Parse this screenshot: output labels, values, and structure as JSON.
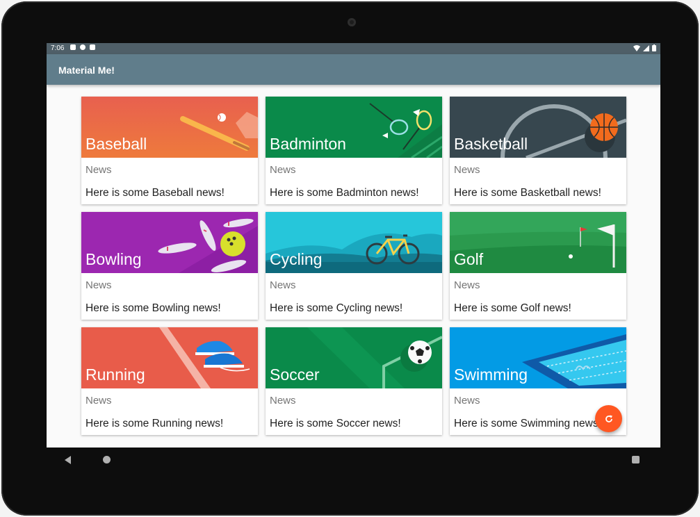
{
  "status_bar": {
    "time": "7:06"
  },
  "app_bar": {
    "title": "Material Me!"
  },
  "cards": [
    {
      "title": "Baseball",
      "subtitle": "News",
      "body": "Here is some Baseball news!",
      "color": "#e85c4a"
    },
    {
      "title": "Badminton",
      "subtitle": "News",
      "body": "Here is some Badminton news!",
      "color": "#0a8a4a"
    },
    {
      "title": "Basketball",
      "subtitle": "News",
      "body": "Here is some Basketball news!",
      "color": "#37474f"
    },
    {
      "title": "Bowling",
      "subtitle": "News",
      "body": "Here is some Bowling news!",
      "color": "#9c27b0"
    },
    {
      "title": "Cycling",
      "subtitle": "News",
      "body": "Here is some Cycling news!",
      "color": "#26c6da"
    },
    {
      "title": "Golf",
      "subtitle": "News",
      "body": "Here is some Golf news!",
      "color": "#2e9e4f"
    },
    {
      "title": "Running",
      "subtitle": "News",
      "body": "Here is some Running news!",
      "color": "#e85c4a"
    },
    {
      "title": "Soccer",
      "subtitle": "News",
      "body": "Here is some Soccer news!",
      "color": "#0a8a4a"
    },
    {
      "title": "Swimming",
      "subtitle": "News",
      "body": "Here is some Swimming news!",
      "color": "#039be5"
    }
  ],
  "fab": {
    "icon": "refresh-icon",
    "color": "#ff5722"
  },
  "nav_bar": {
    "back_icon": "back-icon",
    "home_icon": "home-icon",
    "recents_icon": "recents-icon"
  }
}
